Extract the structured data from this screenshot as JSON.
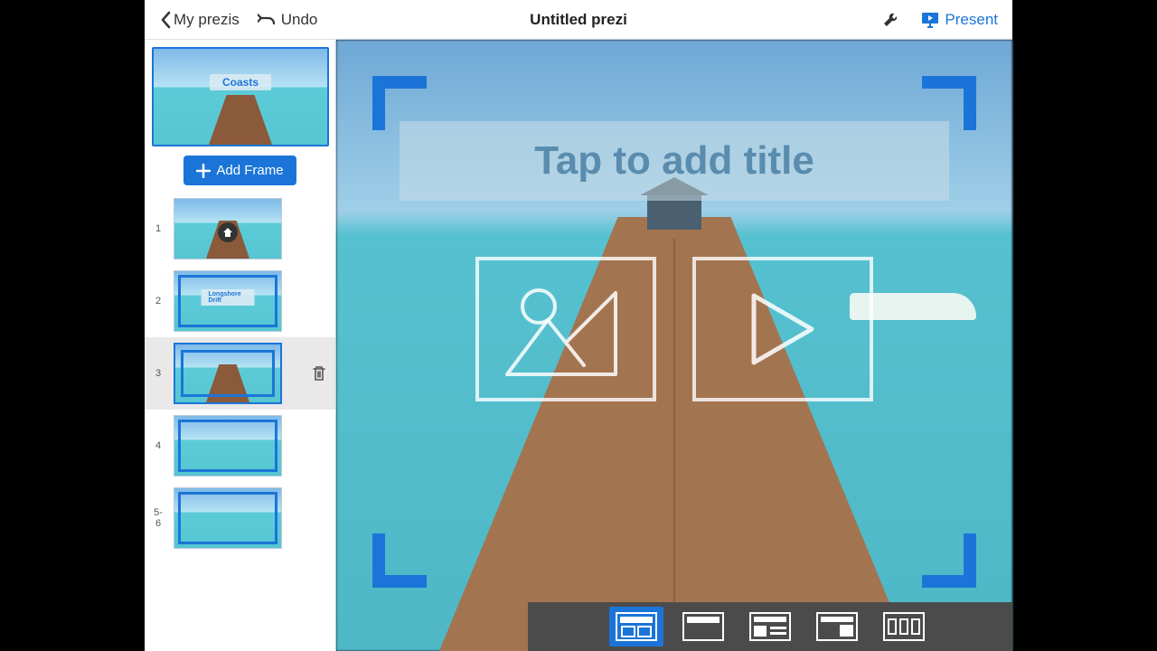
{
  "topbar": {
    "back_label": "My prezis",
    "undo_label": "Undo",
    "title": "Untitled prezi",
    "present_label": "Present"
  },
  "sidebar": {
    "overview_title": "Coasts",
    "add_frame_label": "Add Frame",
    "frames": [
      {
        "num": "1",
        "label": ""
      },
      {
        "num": "2",
        "label": "Longshore Drift"
      },
      {
        "num": "3",
        "label": ""
      },
      {
        "num": "4",
        "label": ""
      },
      {
        "num": "5-6",
        "label": ""
      }
    ]
  },
  "canvas": {
    "title_placeholder": "Tap to add title"
  },
  "colors": {
    "accent": "#1b75d8"
  }
}
